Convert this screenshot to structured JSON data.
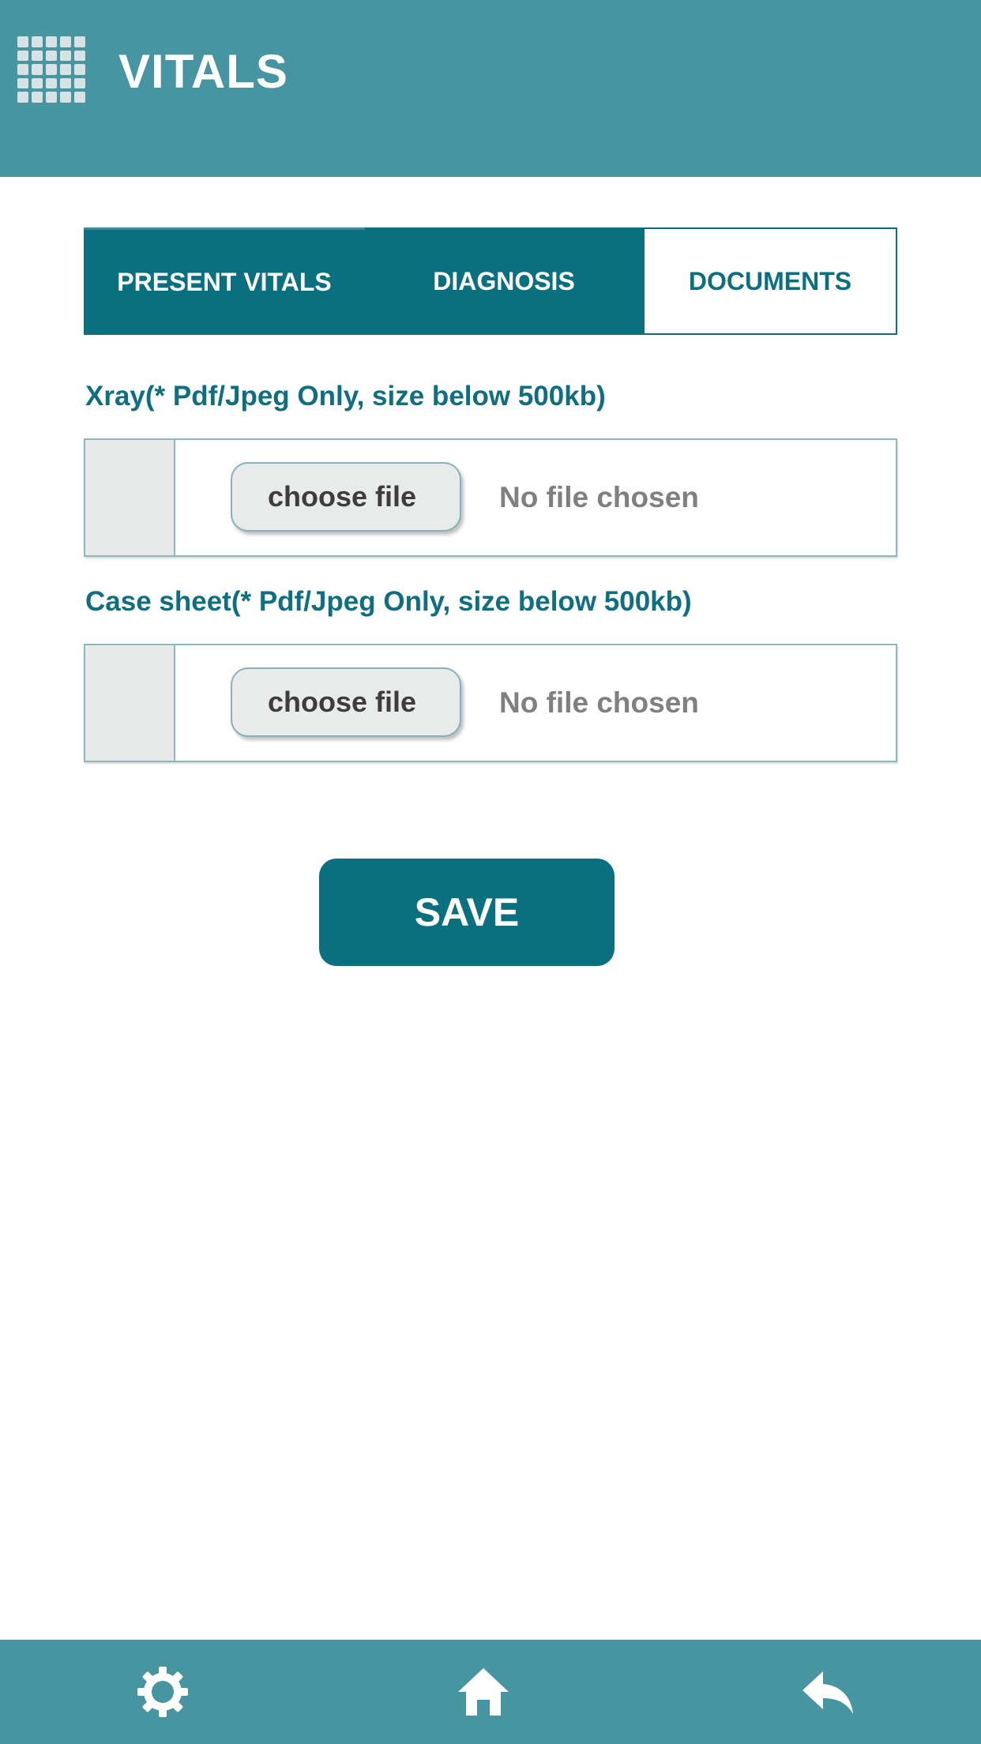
{
  "header": {
    "title": "VITALS",
    "menu_icon": "grid-menu-icon"
  },
  "tabs": [
    {
      "label": "PRESENT VITALS",
      "active": false
    },
    {
      "label": "DIAGNOSIS",
      "active": false
    },
    {
      "label": "DOCUMENTS",
      "active": true
    }
  ],
  "uploads": [
    {
      "label": "Xray(* Pdf/Jpeg Only, size below 500kb)",
      "button_label": "choose file",
      "status": "No file chosen"
    },
    {
      "label": "Case sheet(* Pdf/Jpeg Only, size below 500kb)",
      "button_label": "choose file",
      "status": "No file chosen"
    }
  ],
  "save_label": "SAVE",
  "bottom_nav": {
    "icons": [
      "gear-icon",
      "home-icon",
      "reply-icon"
    ]
  },
  "colors": {
    "header_bg": "#4795a0",
    "accent": "#0a7080",
    "label_text": "#0d6f7f",
    "muted_text": "#808080"
  }
}
